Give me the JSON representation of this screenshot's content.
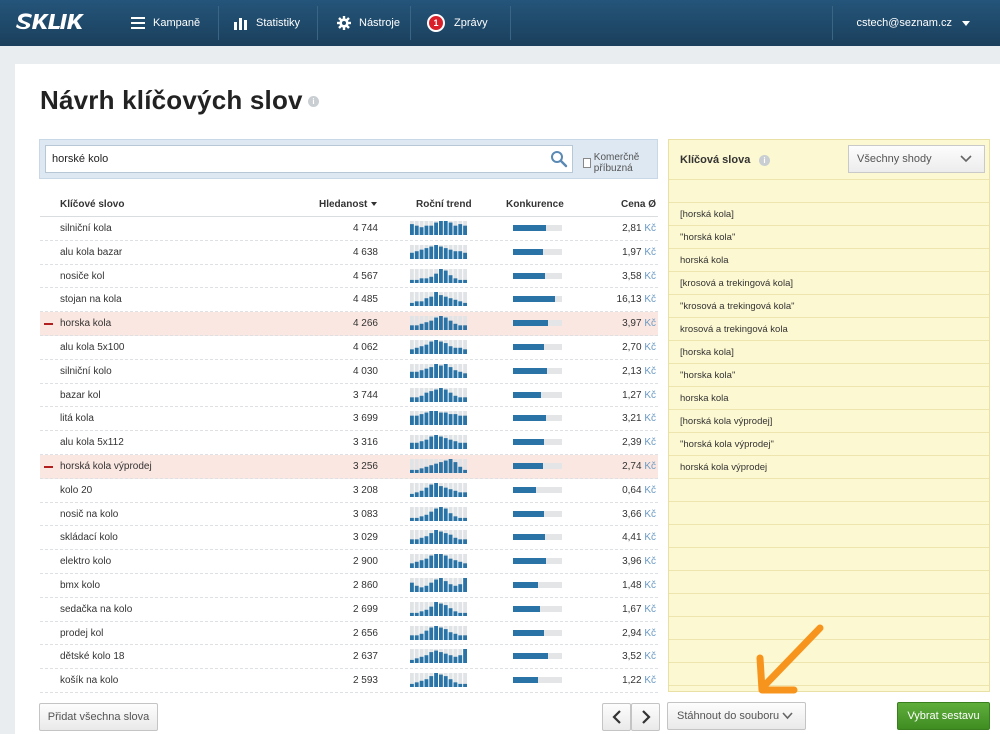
{
  "header": {
    "nav": [
      {
        "label": "Kampaně",
        "icon": "menu-icon"
      },
      {
        "label": "Statistiky",
        "icon": "bar-chart-icon"
      },
      {
        "label": "Nástroje",
        "icon": "gear-icon"
      },
      {
        "label": "Zprávy",
        "icon": "message-badge",
        "badge": "1"
      }
    ],
    "user": "cstech@seznam.cz"
  },
  "page": {
    "title": "Návrh klíčových slov",
    "info_icon": "i"
  },
  "search": {
    "value": "horské kolo",
    "commercial_label": "Komerčně příbuzná"
  },
  "table": {
    "columns": {
      "keyword": "Klíčové slovo",
      "searches": "Hledanost",
      "trend": "Roční trend",
      "competition": "Konkurence",
      "price": "Cena Ø"
    },
    "currency": "Kč",
    "rows": [
      {
        "keyword": "silniční kola",
        "searches": "4 744",
        "competition": 0.68,
        "price": "2,81",
        "selected": false,
        "trend": [
          7,
          6,
          5,
          6,
          6,
          8,
          9,
          9,
          8,
          6,
          7,
          6
        ]
      },
      {
        "keyword": "alu kola bazar",
        "searches": "4 638",
        "competition": 0.62,
        "price": "1,97",
        "selected": false,
        "trend": [
          4,
          5,
          6,
          7,
          8,
          9,
          8,
          7,
          6,
          5,
          5,
          4
        ]
      },
      {
        "keyword": "nosiče kol",
        "searches": "4 567",
        "competition": 0.66,
        "price": "3,58",
        "selected": false,
        "trend": [
          2,
          2,
          3,
          3,
          4,
          6,
          9,
          8,
          5,
          3,
          2,
          2
        ]
      },
      {
        "keyword": "stojan na kola",
        "searches": "4 485",
        "competition": 0.86,
        "price": "16,13",
        "selected": false,
        "trend": [
          2,
          3,
          3,
          5,
          6,
          9,
          7,
          6,
          5,
          4,
          3,
          2
        ]
      },
      {
        "keyword": "horska kola",
        "searches": "4 266",
        "competition": 0.72,
        "price": "3,97",
        "selected": true,
        "trend": [
          3,
          3,
          4,
          5,
          6,
          8,
          9,
          8,
          6,
          4,
          3,
          3
        ]
      },
      {
        "keyword": "alu kola 5x100",
        "searches": "4 062",
        "competition": 0.64,
        "price": "2,70",
        "selected": false,
        "trend": [
          3,
          4,
          5,
          6,
          8,
          9,
          8,
          7,
          5,
          4,
          4,
          3
        ]
      },
      {
        "keyword": "silniční kolo",
        "searches": "4 030",
        "competition": 0.7,
        "price": "2,13",
        "selected": false,
        "trend": [
          4,
          4,
          5,
          6,
          7,
          9,
          8,
          9,
          7,
          5,
          4,
          3
        ]
      },
      {
        "keyword": "bazar kol",
        "searches": "3 744",
        "competition": 0.58,
        "price": "1,27",
        "selected": false,
        "trend": [
          3,
          3,
          4,
          6,
          7,
          8,
          9,
          8,
          6,
          4,
          3,
          3
        ]
      },
      {
        "keyword": "litá kola",
        "searches": "3 699",
        "competition": 0.68,
        "price": "3,21",
        "selected": false,
        "trend": [
          6,
          6,
          7,
          8,
          9,
          9,
          8,
          8,
          7,
          7,
          6,
          6
        ]
      },
      {
        "keyword": "alu kola 5x112",
        "searches": "3 316",
        "competition": 0.64,
        "price": "2,39",
        "selected": false,
        "trend": [
          4,
          4,
          5,
          6,
          8,
          9,
          8,
          7,
          6,
          5,
          4,
          4
        ]
      },
      {
        "keyword": "horská kola výprodej",
        "searches": "3 256",
        "competition": 0.62,
        "price": "2,74",
        "selected": true,
        "trend": [
          2,
          2,
          3,
          4,
          5,
          6,
          7,
          8,
          9,
          7,
          4,
          2
        ]
      },
      {
        "keyword": "kolo 20",
        "searches": "3 208",
        "competition": 0.46,
        "price": "0,64",
        "selected": false,
        "trend": [
          2,
          3,
          4,
          6,
          8,
          9,
          7,
          6,
          5,
          4,
          3,
          3
        ]
      },
      {
        "keyword": "nosič na kolo",
        "searches": "3 083",
        "competition": 0.64,
        "price": "3,66",
        "selected": false,
        "trend": [
          2,
          2,
          3,
          4,
          6,
          8,
          9,
          8,
          5,
          3,
          2,
          2
        ]
      },
      {
        "keyword": "skládací kolo",
        "searches": "3 029",
        "competition": 0.66,
        "price": "4,41",
        "selected": false,
        "trend": [
          3,
          3,
          4,
          5,
          7,
          9,
          8,
          7,
          6,
          4,
          3,
          3
        ]
      },
      {
        "keyword": "elektro kolo",
        "searches": "2 900",
        "competition": 0.68,
        "price": "3,96",
        "selected": false,
        "trend": [
          3,
          4,
          5,
          6,
          8,
          9,
          9,
          8,
          6,
          5,
          4,
          3
        ]
      },
      {
        "keyword": "bmx kolo",
        "searches": "2 860",
        "competition": 0.52,
        "price": "1,48",
        "selected": false,
        "trend": [
          6,
          4,
          3,
          4,
          6,
          8,
          9,
          7,
          5,
          4,
          5,
          9
        ]
      },
      {
        "keyword": "sedačka na kolo",
        "searches": "2 699",
        "competition": 0.56,
        "price": "1,67",
        "selected": false,
        "trend": [
          2,
          2,
          3,
          4,
          6,
          9,
          8,
          7,
          5,
          3,
          2,
          2
        ]
      },
      {
        "keyword": "prodej kol",
        "searches": "2 656",
        "competition": 0.64,
        "price": "2,94",
        "selected": false,
        "trend": [
          3,
          3,
          4,
          6,
          8,
          9,
          8,
          7,
          5,
          4,
          3,
          3
        ]
      },
      {
        "keyword": "dětské kolo 18",
        "searches": "2 637",
        "competition": 0.72,
        "price": "3,52",
        "selected": false,
        "trend": [
          2,
          3,
          4,
          5,
          7,
          8,
          7,
          6,
          5,
          4,
          5,
          9
        ]
      },
      {
        "keyword": "košík na kolo",
        "searches": "2 593",
        "competition": 0.5,
        "price": "1,22",
        "selected": false,
        "trend": [
          2,
          3,
          4,
          5,
          7,
          9,
          8,
          7,
          5,
          3,
          2,
          2
        ]
      }
    ]
  },
  "right_panel": {
    "title": "Klíčová slova",
    "match_select": "Všechny shody",
    "keywords": [
      "[horská kola]",
      "\"horská kola\"",
      "horská kola",
      "[krosová a trekingová kola]",
      "\"krosová a trekingová kola\"",
      "krosová a trekingová kola",
      "[horska kola]",
      "\"horska kola\"",
      "horska kola",
      "[horská kola výprodej]",
      "\"horská kola výprodej\"",
      "horská kola výprodej"
    ]
  },
  "buttons": {
    "add_all": "Přidat všechna slova",
    "download": "Stáhnout do souboru",
    "choose": "Vybrat sestavu"
  },
  "colors": {
    "header_bg": "#1e4968",
    "accent_blue": "#2a73a6",
    "selected_row": "#fbe7e1",
    "panel_yellow": "#fcf8d1",
    "primary_green": "#4a9a2c",
    "annotation_arrow": "#f7941d"
  }
}
